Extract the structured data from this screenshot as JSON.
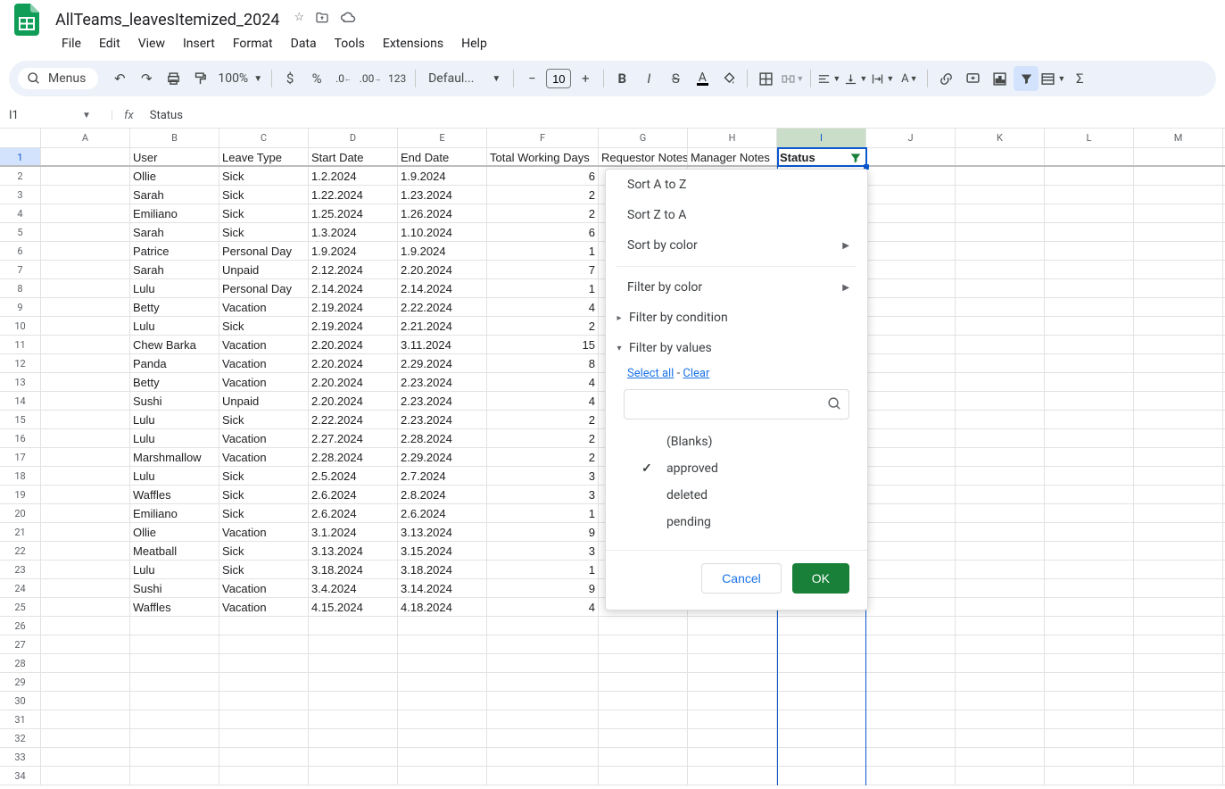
{
  "doc": {
    "title": "AllTeams_leavesItemized_2024"
  },
  "menubar": [
    "File",
    "Edit",
    "View",
    "Insert",
    "Format",
    "Data",
    "Tools",
    "Extensions",
    "Help"
  ],
  "toolbar": {
    "menus_label": "Menus",
    "zoom": "100%",
    "font": "Defaul...",
    "fontsize": "10"
  },
  "namebox": {
    "ref": "I1",
    "formula": "Status"
  },
  "columns": [
    "A",
    "B",
    "C",
    "D",
    "E",
    "F",
    "G",
    "H",
    "I",
    "J",
    "K",
    "L",
    "M"
  ],
  "headers": {
    "B": "User",
    "C": "Leave Type",
    "D": "Start Date",
    "E": "End Date",
    "F": "Total Working Days",
    "G": "Requestor Notes",
    "H": "Manager Notes",
    "I": "Status"
  },
  "rows": [
    {
      "n": 2,
      "B": "Ollie",
      "C": "Sick",
      "D": "1.2.2024",
      "E": "1.9.2024",
      "F": "6"
    },
    {
      "n": 3,
      "B": "Sarah",
      "C": "Sick",
      "D": "1.22.2024",
      "E": "1.23.2024",
      "F": "2"
    },
    {
      "n": 4,
      "B": "Emiliano",
      "C": "Sick",
      "D": "1.25.2024",
      "E": "1.26.2024",
      "F": "2"
    },
    {
      "n": 5,
      "B": "Sarah",
      "C": "Sick",
      "D": "1.3.2024",
      "E": "1.10.2024",
      "F": "6"
    },
    {
      "n": 6,
      "B": "Patrice",
      "C": "Personal Day",
      "D": "1.9.2024",
      "E": "1.9.2024",
      "F": "1"
    },
    {
      "n": 7,
      "B": "Sarah",
      "C": "Unpaid",
      "D": "2.12.2024",
      "E": "2.20.2024",
      "F": "7"
    },
    {
      "n": 8,
      "B": "Lulu",
      "C": "Personal Day",
      "D": "2.14.2024",
      "E": "2.14.2024",
      "F": "1"
    },
    {
      "n": 9,
      "B": "Betty",
      "C": "Vacation",
      "D": "2.19.2024",
      "E": "2.22.2024",
      "F": "4"
    },
    {
      "n": 10,
      "B": "Lulu",
      "C": "Sick",
      "D": "2.19.2024",
      "E": "2.21.2024",
      "F": "2"
    },
    {
      "n": 11,
      "B": "Chew Barka",
      "C": "Vacation",
      "D": "2.20.2024",
      "E": "3.11.2024",
      "F": "15"
    },
    {
      "n": 12,
      "B": "Panda",
      "C": "Vacation",
      "D": "2.20.2024",
      "E": "2.29.2024",
      "F": "8"
    },
    {
      "n": 13,
      "B": "Betty",
      "C": "Vacation",
      "D": "2.20.2024",
      "E": "2.23.2024",
      "F": "4"
    },
    {
      "n": 14,
      "B": "Sushi",
      "C": "Unpaid",
      "D": "2.20.2024",
      "E": "2.23.2024",
      "F": "4"
    },
    {
      "n": 15,
      "B": "Lulu",
      "C": "Sick",
      "D": "2.22.2024",
      "E": "2.23.2024",
      "F": "2"
    },
    {
      "n": 16,
      "B": "Lulu",
      "C": "Vacation",
      "D": "2.27.2024",
      "E": "2.28.2024",
      "F": "2"
    },
    {
      "n": 17,
      "B": "Marshmallow",
      "C": "Vacation",
      "D": "2.28.2024",
      "E": "2.29.2024",
      "F": "2"
    },
    {
      "n": 18,
      "B": "Lulu",
      "C": "Sick",
      "D": "2.5.2024",
      "E": "2.7.2024",
      "F": "3"
    },
    {
      "n": 19,
      "B": "Waffles",
      "C": "Sick",
      "D": "2.6.2024",
      "E": "2.8.2024",
      "F": "3"
    },
    {
      "n": 20,
      "B": "Emiliano",
      "C": "Sick",
      "D": "2.6.2024",
      "E": "2.6.2024",
      "F": "1"
    },
    {
      "n": 21,
      "B": "Ollie",
      "C": "Vacation",
      "D": "3.1.2024",
      "E": "3.13.2024",
      "F": "9"
    },
    {
      "n": 22,
      "B": "Meatball",
      "C": "Sick",
      "D": "3.13.2024",
      "E": "3.15.2024",
      "F": "3"
    },
    {
      "n": 23,
      "B": "Lulu",
      "C": "Sick",
      "D": "3.18.2024",
      "E": "3.18.2024",
      "F": "1"
    },
    {
      "n": 24,
      "B": "Sushi",
      "C": "Vacation",
      "D": "3.4.2024",
      "E": "3.14.2024",
      "F": "9"
    },
    {
      "n": 25,
      "B": "Waffles",
      "C": "Vacation",
      "D": "4.15.2024",
      "E": "4.18.2024",
      "F": "4"
    }
  ],
  "empty_rows": [
    26,
    27,
    28,
    29,
    30,
    31,
    32,
    33,
    34
  ],
  "filter": {
    "sort_az": "Sort A to Z",
    "sort_za": "Sort Z to A",
    "sort_color": "Sort by color",
    "filter_color": "Filter by color",
    "filter_condition": "Filter by condition",
    "filter_values": "Filter by values",
    "select_all": "Select all",
    "clear": "Clear",
    "values": [
      {
        "label": "(Blanks)",
        "checked": false
      },
      {
        "label": "approved",
        "checked": true
      },
      {
        "label": "deleted",
        "checked": false
      },
      {
        "label": "pending",
        "checked": false
      }
    ],
    "cancel": "Cancel",
    "ok": "OK"
  }
}
